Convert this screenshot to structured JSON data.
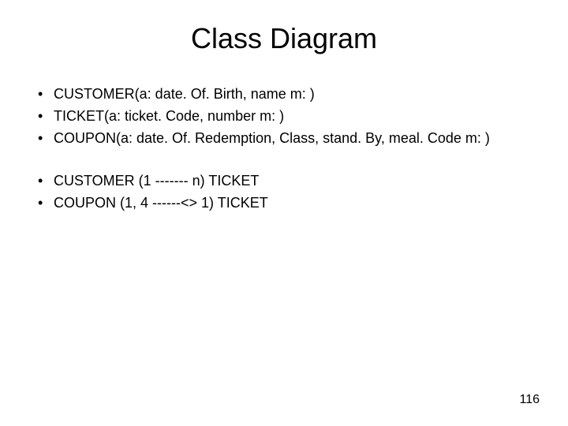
{
  "title": "Class Diagram",
  "bullets_group1": [
    "CUSTOMER(a: date. Of. Birth, name m: )",
    "TICKET(a: ticket. Code, number m: )",
    "COUPON(a: date. Of. Redemption, Class, stand. By, meal. Code m: )"
  ],
  "bullets_group2": [
    "CUSTOMER (1 ------- n) TICKET",
    "COUPON (1, 4 ------<>  1) TICKET"
  ],
  "page_number": "116"
}
